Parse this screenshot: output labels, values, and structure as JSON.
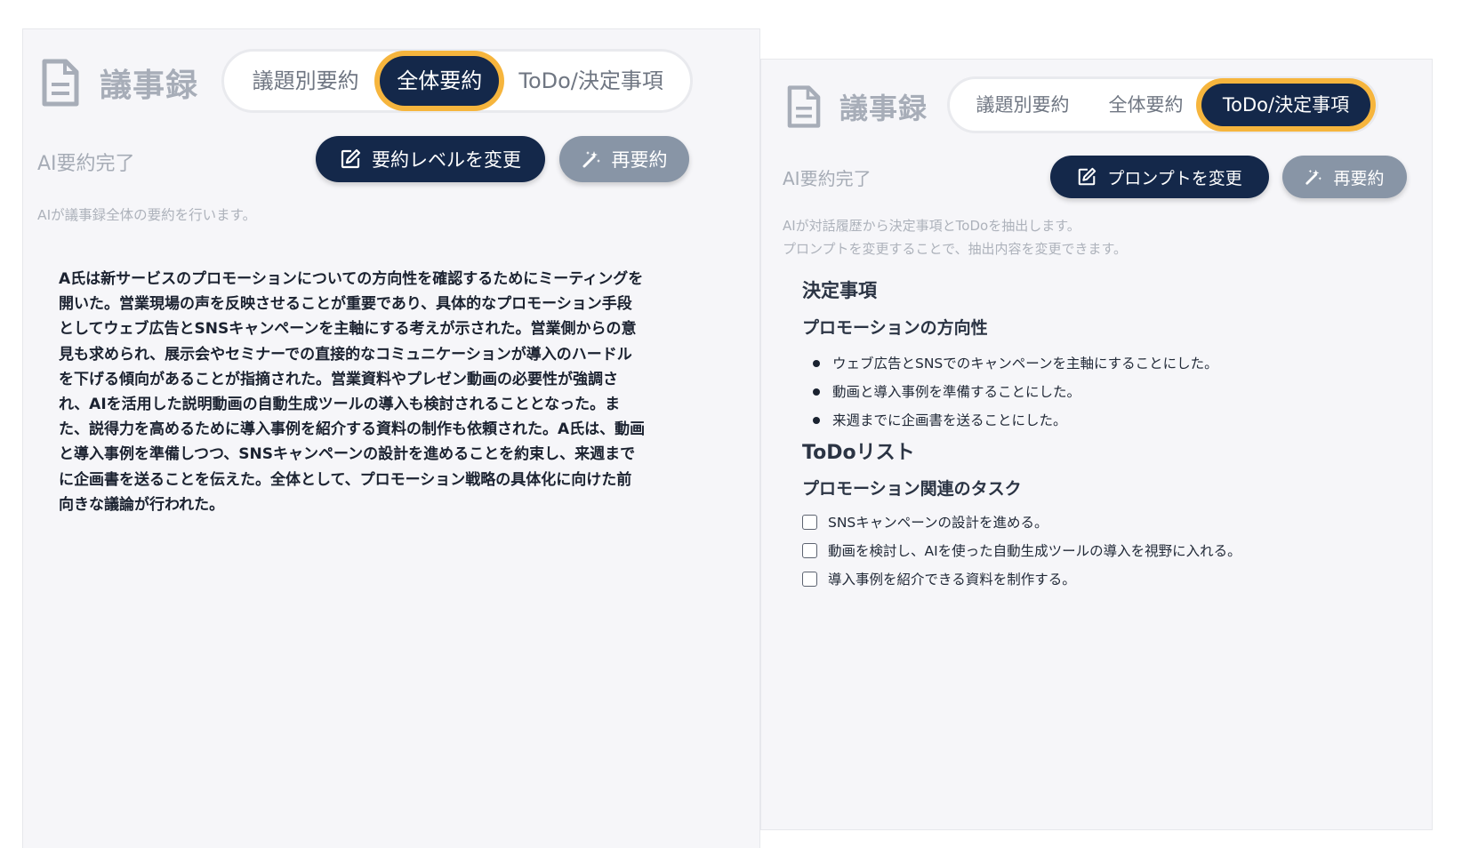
{
  "left": {
    "title": "議事録",
    "tabs": [
      {
        "label": "議題別要約",
        "active": false
      },
      {
        "label": "全体要約",
        "active": true
      },
      {
        "label": "ToDo/決定事項",
        "active": false
      }
    ],
    "status": "AI要約完了",
    "primary_button": "要約レベルを変更",
    "secondary_button": "再要約",
    "description": "AIが議事録全体の要約を行います。",
    "summary_lines": [
      "A氏は新サービスのプロモーションについての方向性を確認するためにミーティングを",
      "開いた。営業現場の声を反映させることが重要であり、具体的なプロモーション手段",
      "としてウェブ広告とSNSキャンペーンを主軸にする考えが示された。営業側からの意",
      "見も求められ、展示会やセミナーでの直接的なコミュニケーションが導入のハードル",
      "を下げる傾向があることが指摘された。営業資料やプレゼン動画の必要性が強調さ",
      "れ、AIを活用した説明動画の自動生成ツールの導入も検討されることとなった。ま",
      "た、説得力を高めるために導入事例を紹介する資料の制作も依頼された。A氏は、動画",
      "と導入事例を準備しつつ、SNSキャンペーンの設計を進めることを約束し、来週まで",
      "に企画書を送ることを伝えた。全体として、プロモーション戦略の具体化に向けた前",
      "向きな議論が行われた。"
    ]
  },
  "right": {
    "title": "議事録",
    "tabs": [
      {
        "label": "議題別要約",
        "active": false
      },
      {
        "label": "全体要約",
        "active": false
      },
      {
        "label": "ToDo/決定事項",
        "active": true
      }
    ],
    "status": "AI要約完了",
    "primary_button": "プロンプトを変更",
    "secondary_button": "再要約",
    "description_lines": [
      "AIが対話履歴から決定事項とToDoを抽出します。",
      "プロンプトを変更することで、抽出内容を変更できます。"
    ],
    "decisions": {
      "heading": "決定事項",
      "subheading": "プロモーションの方向性",
      "items": [
        "ウェブ広告とSNSでのキャンペーンを主軸にすることにした。",
        "動画と導入事例を準備することにした。",
        "来週までに企画書を送ることにした。"
      ]
    },
    "todo": {
      "heading": "ToDoリスト",
      "subheading": "プロモーション関連のタスク",
      "items": [
        {
          "label": "SNSキャンペーンの設計を進める。",
          "checked": false
        },
        {
          "label": "動画を検討し、AIを使った自動生成ツールの導入を視野に入れる。",
          "checked": false
        },
        {
          "label": "導入事例を紹介できる資料を制作する。",
          "checked": false
        }
      ]
    }
  },
  "colors": {
    "navy": "#14284a",
    "highlight": "#f6b53d",
    "secondary_button": "#8895a6",
    "panel_bg": "#f6f6f9"
  },
  "icons": {
    "title": "document-icon",
    "primary_button": "edit-icon",
    "secondary_button": "magic-wand-icon"
  }
}
